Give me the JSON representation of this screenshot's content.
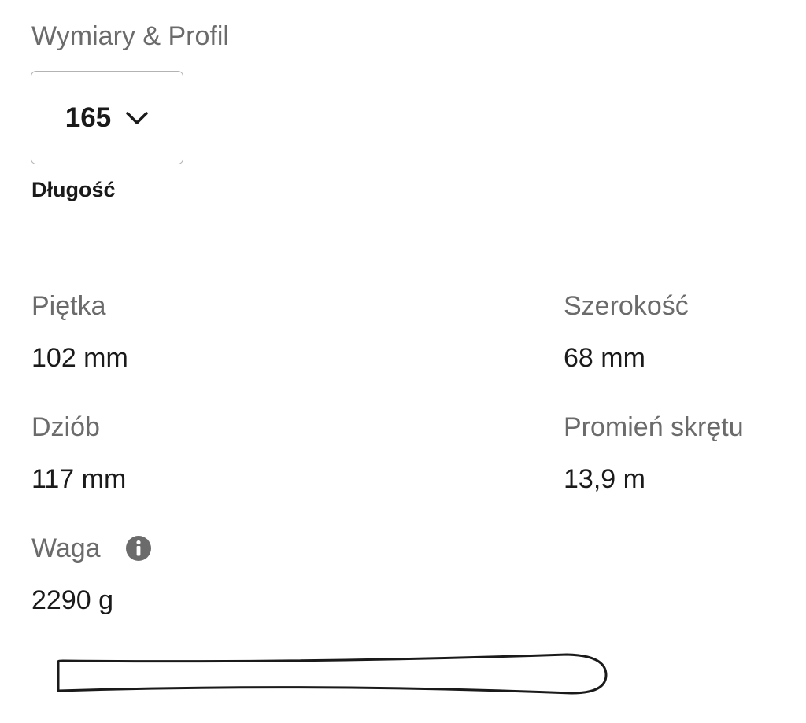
{
  "section": {
    "title": "Wymiary & Profil"
  },
  "length_selector": {
    "selected_value": "165",
    "caption": "Długość"
  },
  "specs": {
    "tail": {
      "label": "Piętka",
      "value": "102 mm"
    },
    "waist": {
      "label": "Szerokość",
      "value": "68 mm"
    },
    "tip": {
      "label": "Dziób",
      "value": "117 mm"
    },
    "radius": {
      "label": "Promień skrętu",
      "value": "13,9 m"
    },
    "weight": {
      "label": "Waga",
      "value": "2290 g",
      "info_icon": "info-icon"
    }
  },
  "profile_graphic": {
    "icon": "ski-outline-icon"
  },
  "colors": {
    "label_gray": "#6b6b6b",
    "text_dark": "#1a1a1a",
    "border_gray": "#b3b3b3"
  }
}
